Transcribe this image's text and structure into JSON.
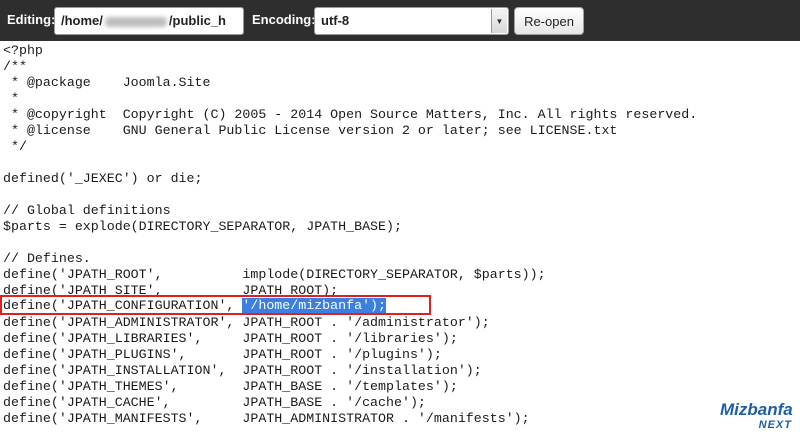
{
  "toolbar": {
    "editing_label": "Editing:",
    "path_prefix": "/home/",
    "path_suffix": "/public_h",
    "encoding_label": "Encoding:",
    "encoding_value": "utf-8",
    "reopen_label": "Re-open"
  },
  "editor": {
    "lines": [
      "<?php",
      "/**",
      " * @package    Joomla.Site",
      " *",
      " * @copyright  Copyright (C) 2005 - 2014 Open Source Matters, Inc. All rights reserved.",
      " * @license    GNU General Public License version 2 or later; see LICENSE.txt",
      " */",
      "",
      "defined('_JEXEC') or die;",
      "",
      "// Global definitions",
      "$parts = explode(DIRECTORY_SEPARATOR, JPATH_BASE);",
      "",
      "// Defines.",
      "define('JPATH_ROOT',          implode(DIRECTORY_SEPARATOR, $parts));",
      "define('JPATH_SITE',          JPATH_ROOT);",
      "define('JPATH_ADMINISTRATOR', JPATH_ROOT . '/administrator');",
      "define('JPATH_LIBRARIES',     JPATH_ROOT . '/libraries');",
      "define('JPATH_PLUGINS',       JPATH_ROOT . '/plugins');",
      "define('JPATH_INSTALLATION',  JPATH_ROOT . '/installation');",
      "define('JPATH_THEMES',        JPATH_BASE . '/templates');",
      "define('JPATH_CACHE',         JPATH_BASE . '/cache');",
      "define('JPATH_MANIFESTS',     JPATH_ADMINISTRATOR . '/manifests');"
    ],
    "highlighted_line": {
      "before": "define('JPATH_CONFIGURATION', ",
      "selected": "'/home/mizbanfa');"
    }
  },
  "watermark": {
    "brand": "Mizbanfa",
    "sub": "NEXT",
    "color": "#1f5fa8"
  },
  "colors": {
    "toolbar_bg": "#2e2e2e",
    "selection": "#3b7fe0",
    "highlight_box": "#e02020"
  }
}
